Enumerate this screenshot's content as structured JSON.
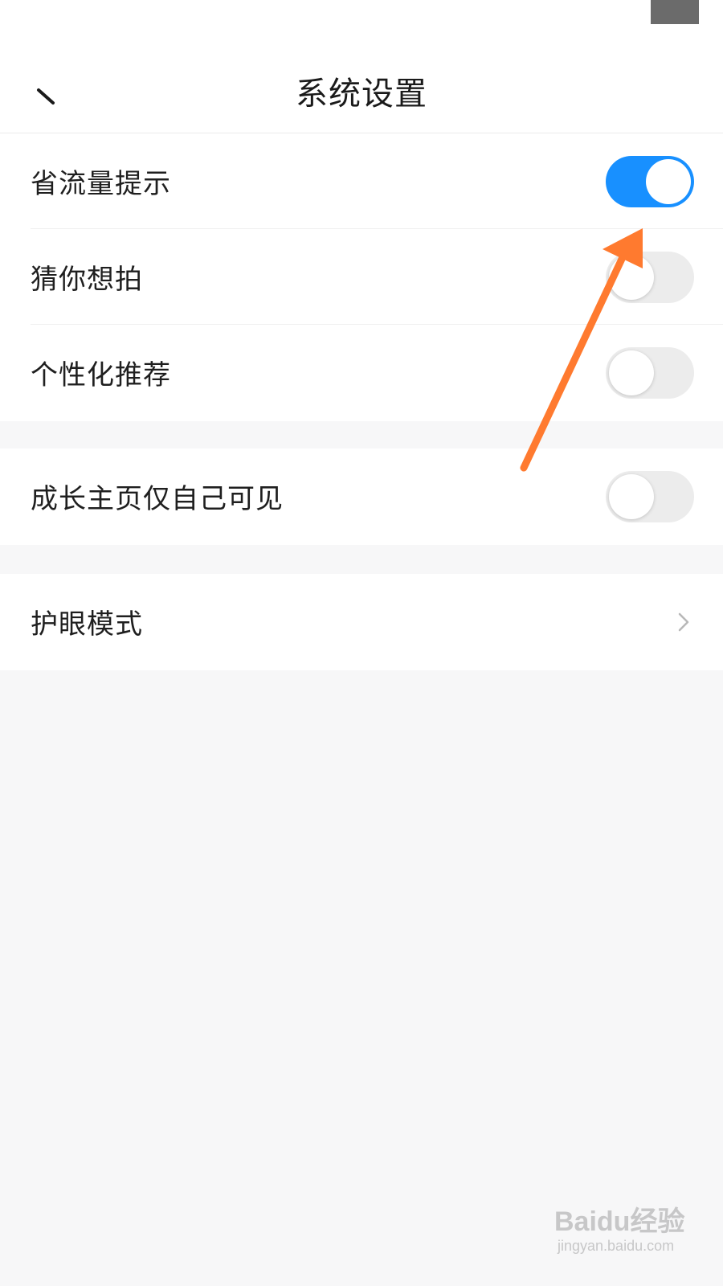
{
  "header": {
    "title": "系统设置",
    "back_icon": "back-arrow-icon"
  },
  "settings": {
    "group1": [
      {
        "label": "省流量提示",
        "control": "toggle",
        "on": true
      },
      {
        "label": "猜你想拍",
        "control": "toggle",
        "on": false
      },
      {
        "label": "个性化推荐",
        "control": "toggle",
        "on": false
      }
    ],
    "group2": [
      {
        "label": "成长主页仅自己可见",
        "control": "toggle",
        "on": false
      }
    ],
    "group3": [
      {
        "label": "护眼模式",
        "control": "chevron"
      }
    ]
  },
  "colors": {
    "toggle_on": "#1890ff",
    "toggle_off": "#ececec",
    "annotation_arrow": "#ff7a2f",
    "background": "#f7f7f8"
  },
  "watermark": {
    "logo": "Baidu经验",
    "url": "jingyan.baidu.com"
  }
}
